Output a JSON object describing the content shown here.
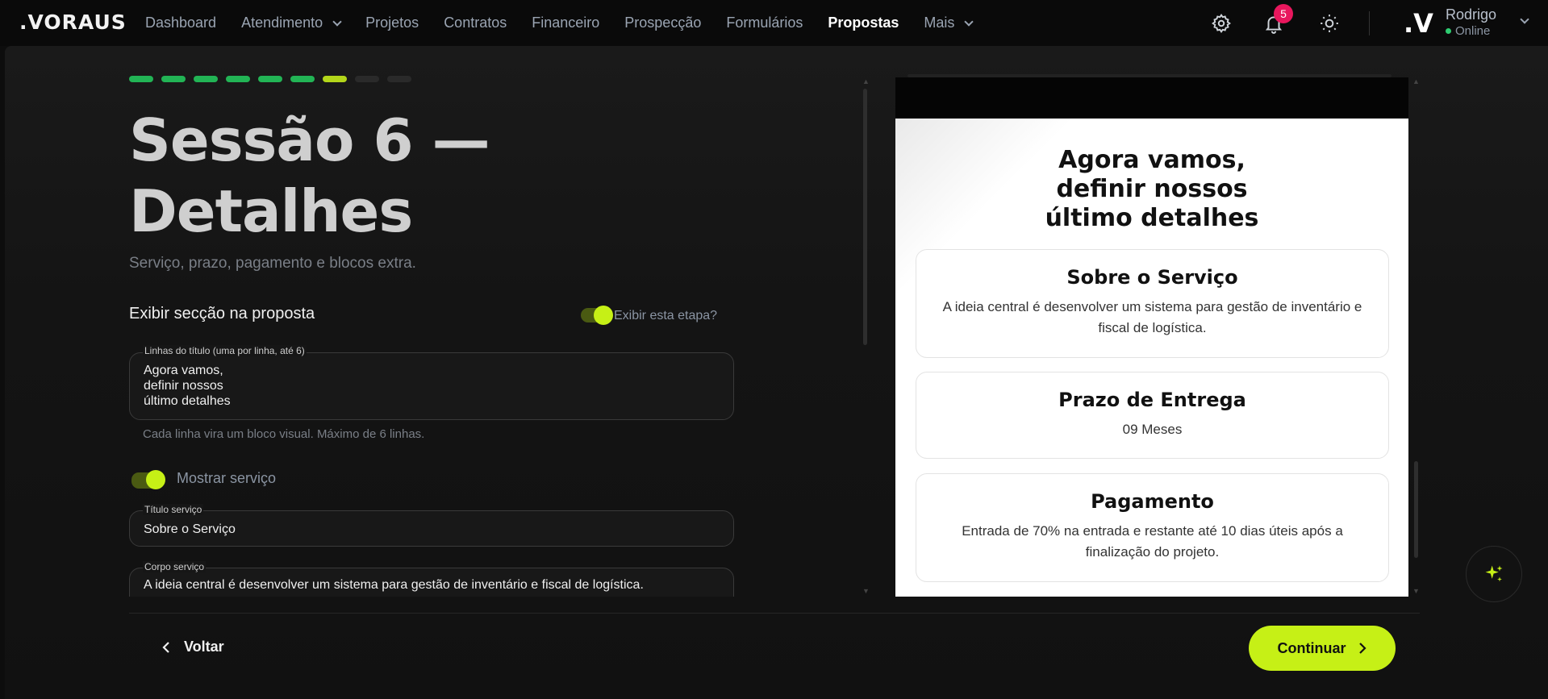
{
  "app": {
    "logo": ".VORAUS",
    "nav": [
      {
        "label": "Dashboard"
      },
      {
        "label": "Atendimento"
      },
      {
        "label": "Projetos"
      },
      {
        "label": "Contratos"
      },
      {
        "label": "Financeiro"
      },
      {
        "label": "Prospecção"
      },
      {
        "label": "Formulários"
      },
      {
        "label": "Propostas"
      },
      {
        "label": "Mais"
      }
    ],
    "notifications_count": "5",
    "user": {
      "initial": ".V",
      "name": "Rodrigo",
      "status": "Online"
    }
  },
  "steps": {
    "total": 9,
    "done": 6,
    "current": 7
  },
  "form": {
    "title": "Sessão 6 — Detalhes",
    "subtitle": "Serviço, prazo, pagamento e blocos extra.",
    "section_label": "Exibir secção na proposta",
    "toggle_step_label": "Exibir esta etapa?",
    "title_lines_label": "Linhas do título (uma por linha, até 6)",
    "title_lines_value": "Agora vamos,\ndefinir nossos\núltimo detalhes",
    "title_lines_hint": "Cada linha vira um bloco visual. Máximo de 6 linhas.",
    "show_service_label": "Mostrar serviço",
    "service_title_label": "Título serviço",
    "service_title_value": "Sobre o Serviço",
    "service_body_label": "Corpo serviço",
    "service_body_value": "A ideia central é desenvolver um sistema para gestão de inventário e fiscal de logística."
  },
  "preview": {
    "title": "Agora vamos,\ndefinir nossos\núltimo detalhes",
    "cards": [
      {
        "title": "Sobre o Serviço",
        "body": "A ideia central é desenvolver um sistema para gestão de inventário e fiscal de logística."
      },
      {
        "title": "Prazo de Entrega",
        "body": "09 Meses"
      },
      {
        "title": "Pagamento",
        "body": "Entrada de 70% na entrada e restante até 10 dias úteis após a finalização do projeto."
      }
    ]
  },
  "footer": {
    "back_label": "Voltar",
    "continue_label": "Continuar"
  },
  "colors": {
    "accent": "#c6f016",
    "done": "#22b455",
    "badge": "#e8175d"
  }
}
